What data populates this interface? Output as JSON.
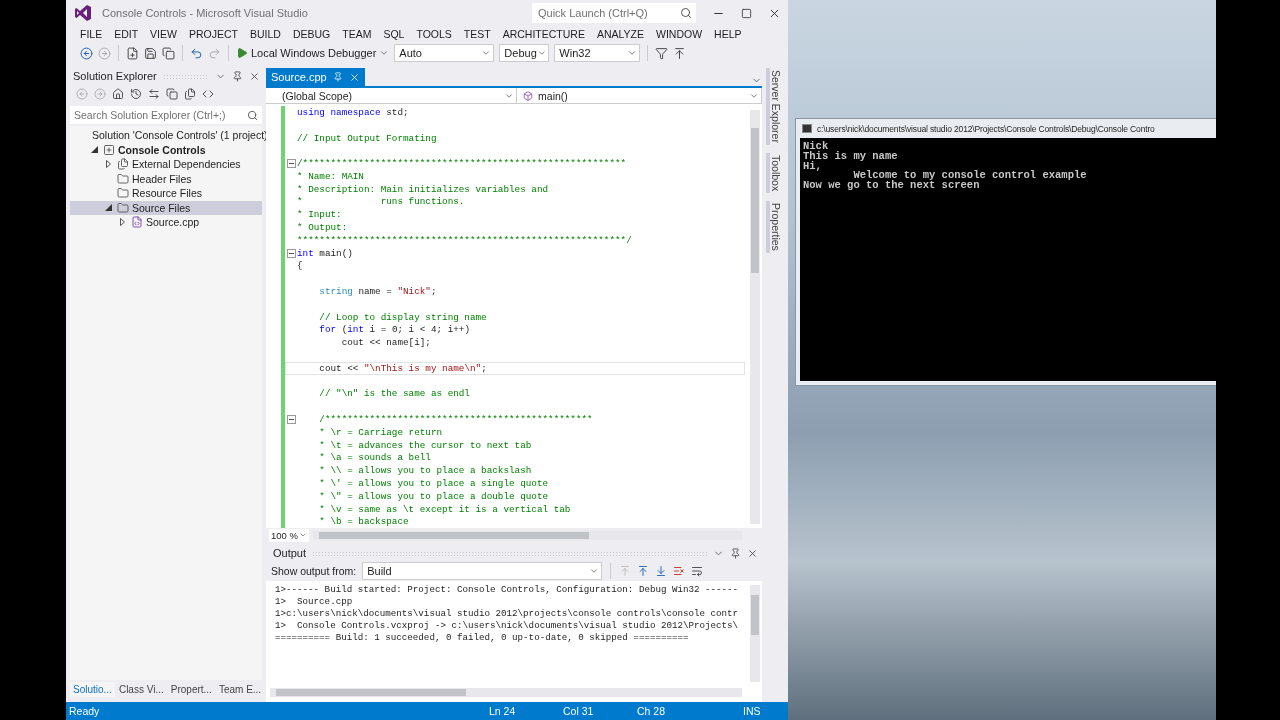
{
  "window": {
    "title": "Console Controls - Microsoft Visual Studio"
  },
  "quick_launch": {
    "placeholder": "Quick Launch (Ctrl+Q)"
  },
  "menu": [
    "FILE",
    "EDIT",
    "VIEW",
    "PROJECT",
    "BUILD",
    "DEBUG",
    "TEAM",
    "SQL",
    "TOOLS",
    "TEST",
    "ARCHITECTURE",
    "ANALYZE",
    "WINDOW",
    "HELP"
  ],
  "toolbar": {
    "debugger": "Local Windows Debugger",
    "combos": [
      "Auto",
      "Debug",
      "Win32"
    ]
  },
  "solution_explorer": {
    "title": "Solution Explorer",
    "search": {
      "placeholder": "Search Solution Explorer (Ctrl+;)"
    },
    "items": [
      {
        "label": "Solution 'Console Controls' (1 project)",
        "kind": "solution",
        "selected": false,
        "children": [
          {
            "label": "Console Controls",
            "kind": "project",
            "expanded": true,
            "selected": false,
            "children": [
              {
                "label": "External Dependencies",
                "kind": "dependencies",
                "expanded": false,
                "selected": false
              },
              {
                "label": "Header Files",
                "kind": "folder",
                "selected": false
              },
              {
                "label": "Resource Files",
                "kind": "folder",
                "selected": false
              },
              {
                "label": "Source Files",
                "kind": "folder",
                "expanded": true,
                "selected": true,
                "children": [
                  {
                    "label": "Source.cpp",
                    "kind": "file",
                    "expanded": false,
                    "selected": false
                  }
                ]
              }
            ]
          }
        ]
      }
    ]
  },
  "bottom_tabs": [
    {
      "label": "Solutio...",
      "selected": true
    },
    {
      "label": "Class Vi...",
      "selected": false
    },
    {
      "label": "Propert...",
      "selected": false
    },
    {
      "label": "Team E...",
      "selected": false
    }
  ],
  "editor": {
    "tabs": [
      {
        "label": "Source.cpp",
        "selected": true
      }
    ],
    "scope": "(Global Scope)",
    "member": "main()",
    "zoom": "100 %",
    "lines": [
      {
        "gap_before": false,
        "fold": false,
        "current": false,
        "segments": [
          {
            "kind": "keyword",
            "text": "using namespace"
          },
          {
            "kind": "plain",
            "text": " std;"
          }
        ]
      },
      {
        "gap_before": true,
        "fold": false,
        "current": false,
        "segments": [
          {
            "kind": "comment",
            "text": "// Input Output Formating"
          }
        ]
      },
      {
        "gap_before": true,
        "fold": true,
        "current": false,
        "segments": [
          {
            "kind": "comment",
            "text": "/**********************************************************"
          }
        ]
      },
      {
        "gap_before": false,
        "fold": false,
        "current": false,
        "segments": [
          {
            "kind": "comment",
            "text": "* Name: MAIN"
          }
        ]
      },
      {
        "gap_before": false,
        "fold": false,
        "current": false,
        "segments": [
          {
            "kind": "comment",
            "text": "* Description: Main initializes variables and"
          }
        ]
      },
      {
        "gap_before": false,
        "fold": false,
        "current": false,
        "segments": [
          {
            "kind": "comment",
            "text": "*              runs functions."
          }
        ]
      },
      {
        "gap_before": false,
        "fold": false,
        "current": false,
        "segments": [
          {
            "kind": "comment",
            "text": "* Input:"
          }
        ]
      },
      {
        "gap_before": false,
        "fold": false,
        "current": false,
        "segments": [
          {
            "kind": "comment",
            "text": "* Output:"
          }
        ]
      },
      {
        "gap_before": false,
        "fold": false,
        "current": false,
        "segments": [
          {
            "kind": "comment",
            "text": "***********************************************************/"
          }
        ]
      },
      {
        "gap_before": false,
        "fold": true,
        "current": false,
        "segments": [
          {
            "kind": "keyword",
            "text": "int"
          },
          {
            "kind": "plain",
            "text": " main()"
          }
        ]
      },
      {
        "gap_before": false,
        "fold": false,
        "current": false,
        "segments": [
          {
            "kind": "plain",
            "text": "{"
          }
        ]
      },
      {
        "gap_before": true,
        "fold": false,
        "current": false,
        "segments": [
          {
            "kind": "type",
            "text": "    string"
          },
          {
            "kind": "plain",
            "text": " name = "
          },
          {
            "kind": "string",
            "text": "\"Nick\""
          },
          {
            "kind": "plain",
            "text": ";"
          }
        ]
      },
      {
        "gap_before": true,
        "fold": false,
        "current": false,
        "segments": [
          {
            "kind": "comment",
            "text": "    // Loop to display string name"
          }
        ]
      },
      {
        "gap_before": false,
        "fold": false,
        "current": false,
        "segments": [
          {
            "kind": "keyword",
            "text": "    for"
          },
          {
            "kind": "plain",
            "text": " ("
          },
          {
            "kind": "keyword",
            "text": "int"
          },
          {
            "kind": "plain",
            "text": " i = 0; i < 4; i++)"
          }
        ]
      },
      {
        "gap_before": false,
        "fold": false,
        "current": false,
        "segments": [
          {
            "kind": "plain",
            "text": "        cout << name[i];"
          }
        ]
      },
      {
        "gap_before": true,
        "fold": false,
        "current": true,
        "segments": [
          {
            "kind": "plain",
            "text": "    cout << "
          },
          {
            "kind": "string",
            "text": "\"\\nThis is my name\\n\""
          },
          {
            "kind": "plain",
            "text": ";"
          }
        ]
      },
      {
        "gap_before": true,
        "fold": false,
        "current": false,
        "segments": [
          {
            "kind": "comment",
            "text": "    // \"\\n\" is the same as endl"
          }
        ]
      },
      {
        "gap_before": true,
        "fold": true,
        "current": false,
        "segments": [
          {
            "kind": "comment",
            "text": "    /************************************************"
          }
        ]
      },
      {
        "gap_before": false,
        "fold": false,
        "current": false,
        "segments": [
          {
            "kind": "comment",
            "text": "    * \\r = Carriage return"
          }
        ]
      },
      {
        "gap_before": false,
        "fold": false,
        "current": false,
        "segments": [
          {
            "kind": "comment",
            "text": "    * \\t = advances the cursor to next tab"
          }
        ]
      },
      {
        "gap_before": false,
        "fold": false,
        "current": false,
        "segments": [
          {
            "kind": "comment",
            "text": "    * \\a = sounds a bell"
          }
        ]
      },
      {
        "gap_before": false,
        "fold": false,
        "current": false,
        "segments": [
          {
            "kind": "comment",
            "text": "    * \\\\ = allows you to place a backslash"
          }
        ]
      },
      {
        "gap_before": false,
        "fold": false,
        "current": false,
        "segments": [
          {
            "kind": "comment",
            "text": "    * \\' = allows you to place a single quote"
          }
        ]
      },
      {
        "gap_before": false,
        "fold": false,
        "current": false,
        "segments": [
          {
            "kind": "comment",
            "text": "    * \\\" = allows you to place a double quote"
          }
        ]
      },
      {
        "gap_before": false,
        "fold": false,
        "current": false,
        "segments": [
          {
            "kind": "comment",
            "text": "    * \\v = same as \\t except it is a vertical tab"
          }
        ]
      },
      {
        "gap_before": false,
        "fold": false,
        "current": false,
        "segments": [
          {
            "kind": "comment",
            "text": "    * \\b = backspace"
          }
        ]
      }
    ]
  },
  "side_tabs": [
    "Server Explorer",
    "Toolbox",
    "Properties"
  ],
  "output": {
    "title": "Output",
    "source_label": "Show output from:",
    "source": "Build",
    "lines": [
      "1>------ Build started: Project: Console Controls, Configuration: Debug Win32 ------",
      "1>  Source.cpp",
      "1>c:\\users\\nick\\documents\\visual studio 2012\\projects\\console controls\\console contr",
      "1>  Console Controls.vcxproj -> c:\\users\\nick\\documents\\visual studio 2012\\Projects\\",
      "========== Build: 1 succeeded, 0 failed, 0 up-to-date, 0 skipped =========="
    ]
  },
  "status_bar": {
    "message": "Ready",
    "line": "Ln 24",
    "column": "Col 31",
    "char": "Ch 28",
    "mode": "INS"
  },
  "console": {
    "title": "c:\\users\\nick\\documents\\visual studio 2012\\Projects\\Console Controls\\Debug\\Console Contro",
    "lines": [
      "Nick",
      "This is my name",
      "Hi,",
      "        Welcome to my console control example",
      "Now we go to the next screen"
    ]
  }
}
